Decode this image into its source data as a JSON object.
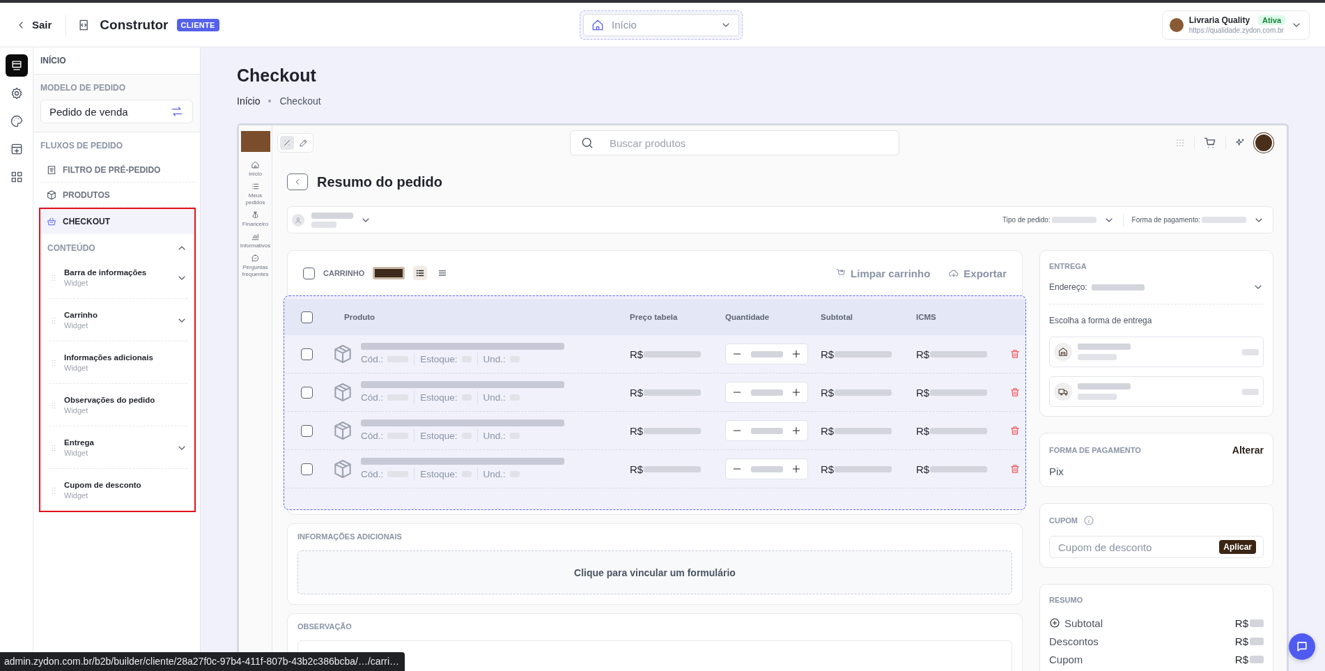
{
  "topbar": {
    "back": "Sair",
    "title": "Construtor",
    "badge": "CLIENTE",
    "page_select": "Início",
    "store": {
      "name": "Livraria Quality",
      "status": "Ativa",
      "url": "https://qualidade.zydon.com.br"
    }
  },
  "rail": [
    {
      "kind": "layout",
      "selected": true
    },
    {
      "kind": "gear",
      "selected": false
    },
    {
      "kind": "palette",
      "selected": false
    },
    {
      "kind": "grid-plus",
      "selected": false
    },
    {
      "kind": "apps",
      "selected": false
    }
  ],
  "sidebar": {
    "home": "INÍCIO",
    "model_label": "MODELO DE PEDIDO",
    "model_value": "Pedido de venda",
    "flows_label": "FLUXOS DE PEDIDO",
    "flows": [
      {
        "label": "FILTRO DE PRÉ-PEDIDO",
        "kind": "filter",
        "selected": false
      },
      {
        "label": "PRODUTOS",
        "kind": "box",
        "selected": false
      },
      {
        "label": "CHECKOUT",
        "kind": "basket",
        "selected": true
      }
    ],
    "content": {
      "label": "CONTEÚDO",
      "expanded": true,
      "widgets": [
        {
          "name": "Barra de informações",
          "type": "Widget",
          "expandable": true
        },
        {
          "name": "Carrinho",
          "type": "Widget",
          "expandable": true
        },
        {
          "name": "Informações adicionais",
          "type": "Widget",
          "expandable": false
        },
        {
          "name": "Observações do pedido",
          "type": "Widget",
          "expandable": false
        },
        {
          "name": "Entrega",
          "type": "Widget",
          "expandable": true
        },
        {
          "name": "Cupom de desconto",
          "type": "Widget",
          "expandable": false
        }
      ]
    }
  },
  "page": {
    "title": "Checkout",
    "breadcrumb": [
      "Início",
      "Checkout"
    ]
  },
  "preview": {
    "nav": [
      {
        "label": "Início",
        "kind": "home"
      },
      {
        "label": "Meus pedidos",
        "kind": "list"
      },
      {
        "label": "Financeiro",
        "kind": "money"
      },
      {
        "label": "Informativos",
        "kind": "chart"
      },
      {
        "label": "Perguntas frequentes",
        "kind": "chat"
      }
    ],
    "search": {
      "placeholder": "Buscar produtos"
    },
    "title": "Resumo do pedido",
    "filters": [
      "Tipo de pedido:",
      "Forma de pagamento:"
    ],
    "cart": {
      "label": "CARRINHO",
      "checked": false,
      "table_checked": false,
      "view_modes": [
        {
          "kind": "detailed",
          "selected": true
        },
        {
          "kind": "compact",
          "selected": false
        }
      ],
      "actions": [
        {
          "label": "Limpar carrinho",
          "kind": "cart-clear"
        },
        {
          "label": "Exportar",
          "kind": "cloud"
        }
      ],
      "columns": [
        "Produto",
        "Preço tabela",
        "Quantidade",
        "Subtotal",
        "ICMS"
      ],
      "rows": [
        {
          "checked": false,
          "code": "Cód.:",
          "stock": "Estoque:",
          "unit": "Und.:",
          "price": "R$",
          "subtotal": "R$",
          "icms": "R$"
        },
        {
          "checked": false,
          "code": "Cód.:",
          "stock": "Estoque:",
          "unit": "Und.:",
          "price": "R$",
          "subtotal": "R$",
          "icms": "R$"
        },
        {
          "checked": false,
          "code": "Cód.:",
          "stock": "Estoque:",
          "unit": "Und.:",
          "price": "R$",
          "subtotal": "R$",
          "icms": "R$"
        },
        {
          "checked": false,
          "code": "Cód.:",
          "stock": "Estoque:",
          "unit": "Und.:",
          "price": "R$",
          "subtotal": "R$",
          "icms": "R$"
        }
      ]
    },
    "info": {
      "label": "INFORMAÇÕES ADICIONAIS",
      "link": "Clique para vincular um formulário"
    },
    "notes": {
      "label": "OBSERVAÇÃO"
    },
    "delivery": {
      "label": "ENTREGA",
      "address": "Endereço:",
      "choose": "Escolha a forma de entrega",
      "options": [
        {
          "kind": "store"
        },
        {
          "kind": "truck"
        }
      ]
    },
    "payment": {
      "label": "FORMA DE PAGAMENTO",
      "action": "Alterar",
      "value": "Pix"
    },
    "coupon": {
      "label": "CUPOM",
      "placeholder": "Cupom de desconto",
      "button": "Aplicar"
    },
    "summary": {
      "label": "RESUMO",
      "lines": [
        {
          "label": "Subtotal",
          "value": "R$",
          "expandable": true
        },
        {
          "label": "Descontos",
          "value": "R$",
          "expandable": false
        },
        {
          "label": "Cupom",
          "value": "R$",
          "expandable": false
        }
      ]
    }
  },
  "status_url": "admin.zydon.com.br/b2b/builder/cliente/28a27f0c-97b4-411f-807b-43b2c386bcba/…/carri…"
}
